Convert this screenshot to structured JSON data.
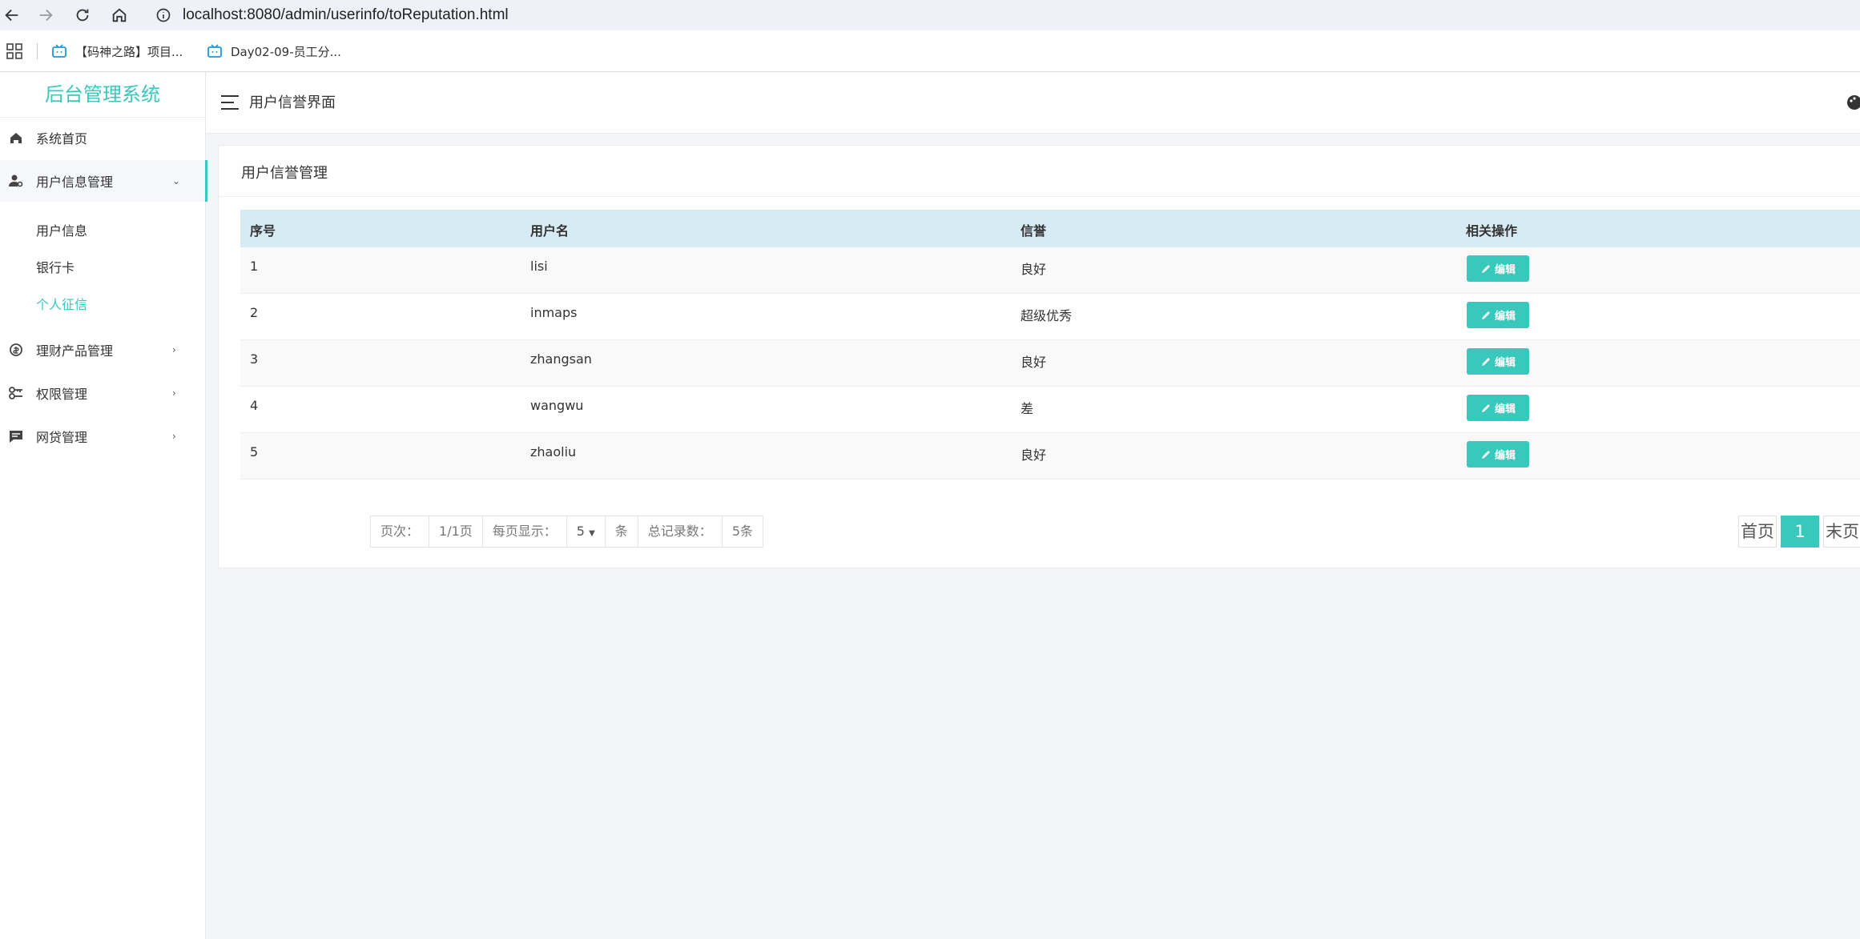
{
  "browser": {
    "url": "localhost:8080/admin/userinfo/toReputation.html",
    "bookmarks": [
      {
        "label": "【码神之路】项目..."
      },
      {
        "label": "Day02-09-员工分..."
      }
    ]
  },
  "sidebar": {
    "logo": "后台管理系统",
    "items": [
      {
        "label": "系统首页",
        "icon": "home-icon"
      },
      {
        "label": "用户信息管理",
        "icon": "user-settings-icon",
        "arrow": "⌄"
      },
      {
        "label": "理财产品管理",
        "icon": "coin-icon",
        "arrow": "›"
      },
      {
        "label": "权限管理",
        "icon": "key-icon",
        "arrow": "›"
      },
      {
        "label": "网贷管理",
        "icon": "message-icon",
        "arrow": "›"
      }
    ],
    "subitems": [
      {
        "label": "用户信息"
      },
      {
        "label": "银行卡"
      },
      {
        "label": "个人征信"
      }
    ]
  },
  "header": {
    "title": "用户信誉界面"
  },
  "card": {
    "title": "用户信誉管理",
    "columns": [
      "序号",
      "用户名",
      "信誉",
      "相关操作"
    ],
    "edit_label": "编辑",
    "rows": [
      {
        "id": "1",
        "name": "lisi",
        "rep": "良好"
      },
      {
        "id": "2",
        "name": "inmaps",
        "rep": "超级优秀"
      },
      {
        "id": "3",
        "name": "zhangsan",
        "rep": "良好"
      },
      {
        "id": "4",
        "name": "wangwu",
        "rep": "差"
      },
      {
        "id": "5",
        "name": "zhaoliu",
        "rep": "良好"
      }
    ]
  },
  "pagination": {
    "page_label": "页次：",
    "page_value": "1/1页",
    "per_page_label": "每页显示：",
    "per_page_value": "5",
    "unit": "条",
    "total_label": "总记录数：",
    "total_value": "5条",
    "first": "首页",
    "current": "1",
    "last": "末页"
  },
  "colors": {
    "accent": "#38c8bc",
    "header_row": "#d7ebf4"
  }
}
